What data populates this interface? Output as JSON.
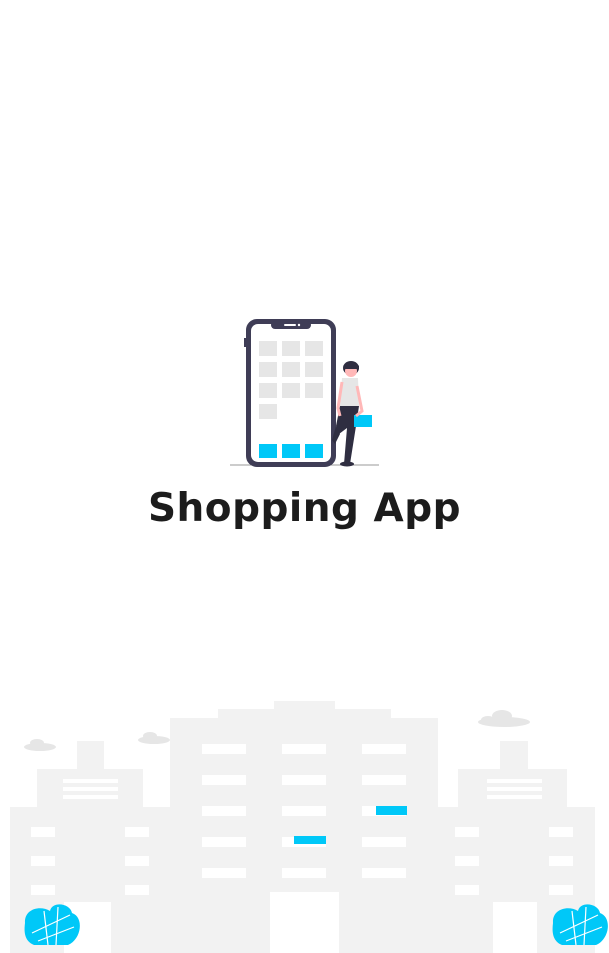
{
  "app": {
    "title": "Shopping App"
  },
  "colors": {
    "background": "#ffffff",
    "accent": "#00c8f8",
    "phone_frame": "#3f3d56",
    "app_tile": "#e6e6e6",
    "building": "#f2f2f2",
    "title_text": "#1c1c1c"
  },
  "illustration": {
    "phone_tile_count": 10,
    "phone_dock_count": 3
  }
}
